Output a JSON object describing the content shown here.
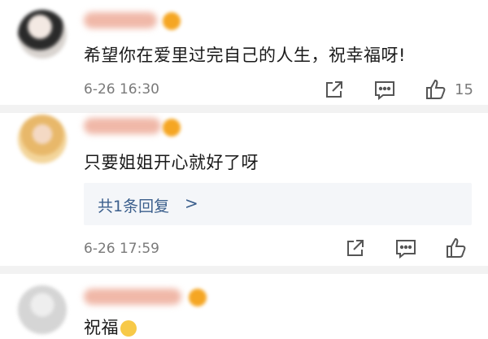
{
  "comments": [
    {
      "text": "希望你在爱里过完自己的人生，祝幸福呀!",
      "time": "6-26 16:30",
      "likes": "15"
    },
    {
      "text": "只要姐姐开心就好了呀",
      "time": "6-26 17:59",
      "reply_link": "共1条回复",
      "reply_chevron": ">"
    },
    {
      "text": "祝福"
    }
  ],
  "icons": {
    "share": "share-icon",
    "comment": "comment-icon",
    "like": "like-icon"
  },
  "colors": {
    "link": "#3a5e8c",
    "meta": "#7a7a7a",
    "badge": "#f5a623"
  }
}
